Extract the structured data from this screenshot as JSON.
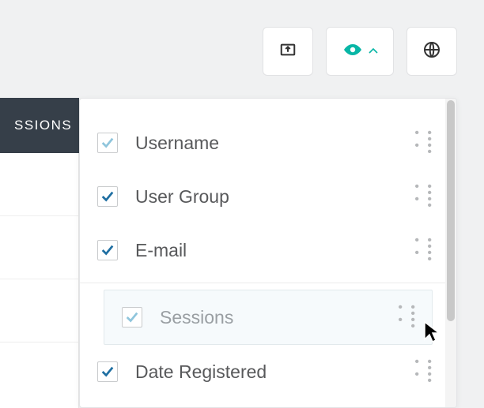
{
  "toolbar": {
    "items": [
      {
        "name": "export-button",
        "icon": "export"
      },
      {
        "name": "visibility-button",
        "icon": "eye",
        "dropdown": true,
        "accent": "#08b6a6"
      },
      {
        "name": "globe-button",
        "icon": "globe"
      }
    ]
  },
  "tabs": {
    "active_partial": "SSIONS"
  },
  "columns": [
    {
      "label": "Username",
      "checked": true,
      "muted": true
    },
    {
      "label": "User Group",
      "checked": true,
      "muted": false
    },
    {
      "label": "E-mail",
      "checked": true,
      "muted": false
    },
    {
      "label": "Sessions",
      "checked": true,
      "muted": true,
      "dragging": true
    },
    {
      "label": "Date Registered",
      "checked": true,
      "muted": false
    }
  ],
  "colors": {
    "check_primary": "#1f6fa2",
    "check_muted": "#8fc5dc",
    "accent": "#08b6a6",
    "tab_bg": "#363f49"
  }
}
